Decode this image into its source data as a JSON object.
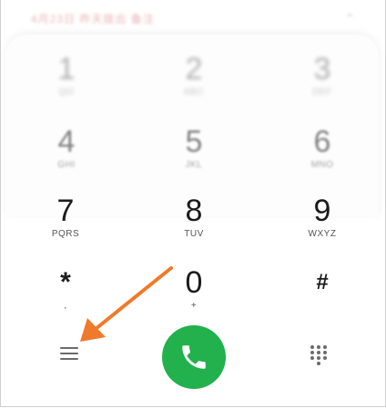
{
  "hint": {
    "text": "4月23日 昨天拨出 备注",
    "icon": "close-icon"
  },
  "keypad": [
    {
      "digit": "1",
      "letters": "QO"
    },
    {
      "digit": "2",
      "letters": "ABC"
    },
    {
      "digit": "3",
      "letters": "DEF"
    },
    {
      "digit": "4",
      "letters": "GHI"
    },
    {
      "digit": "5",
      "letters": "JKL"
    },
    {
      "digit": "6",
      "letters": "MNO"
    },
    {
      "digit": "7",
      "letters": "PQRS"
    },
    {
      "digit": "8",
      "letters": "TUV"
    },
    {
      "digit": "9",
      "letters": "WXYZ"
    },
    {
      "digit": "*",
      "letters": ","
    },
    {
      "digit": "0",
      "letters": "+"
    },
    {
      "digit": "#",
      "letters": ""
    }
  ],
  "actions": {
    "menu_icon": "menu-icon",
    "call_icon": "phone-icon",
    "keypad_icon": "dialpad-icon"
  },
  "colors": {
    "call": "#22b14c",
    "arrow": "#f07a2a"
  }
}
